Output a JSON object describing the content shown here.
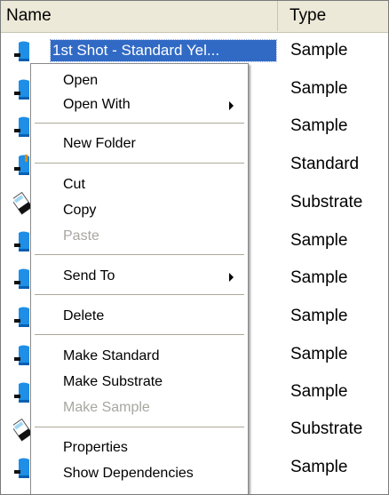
{
  "columns": {
    "name": "Name",
    "type": "Type"
  },
  "rows": [
    {
      "name": "1st Shot - Standard Yel...",
      "type": "Sample",
      "icon": "sample-icon",
      "selected": true
    },
    {
      "name": "",
      "type": "Sample",
      "icon": "sample-icon"
    },
    {
      "name": "",
      "type": "Sample",
      "icon": "sample-icon"
    },
    {
      "name": "",
      "type": "Standard",
      "icon": "standard-icon"
    },
    {
      "name": "",
      "type": "Substrate",
      "icon": "substrate-icon"
    },
    {
      "name": "",
      "type": "Sample",
      "icon": "sample-icon"
    },
    {
      "name": "",
      "type": "Sample",
      "icon": "sample-icon"
    },
    {
      "name": "",
      "type": "Sample",
      "icon": "sample-icon"
    },
    {
      "name": "",
      "type": "Sample",
      "icon": "sample-icon"
    },
    {
      "name": "",
      "type": "Sample",
      "icon": "sample-icon"
    },
    {
      "name": "",
      "type": "Substrate",
      "icon": "substrate-icon"
    },
    {
      "name": "",
      "type": "Sample",
      "icon": "sample-icon"
    }
  ],
  "menu": {
    "open": "Open",
    "open_with": "Open With",
    "new_folder": "New Folder",
    "cut": "Cut",
    "copy": "Copy",
    "paste": "Paste",
    "send_to": "Send To",
    "delete": "Delete",
    "make_standard": "Make Standard",
    "make_substrate": "Make Substrate",
    "make_sample": "Make Sample",
    "properties": "Properties",
    "show_dependencies": "Show Dependencies"
  },
  "colors": {
    "selection": "#316ac5",
    "header": "#ece9d8",
    "disabled_text": "#a7a69f",
    "icon_blue": "#1e8ee6"
  }
}
